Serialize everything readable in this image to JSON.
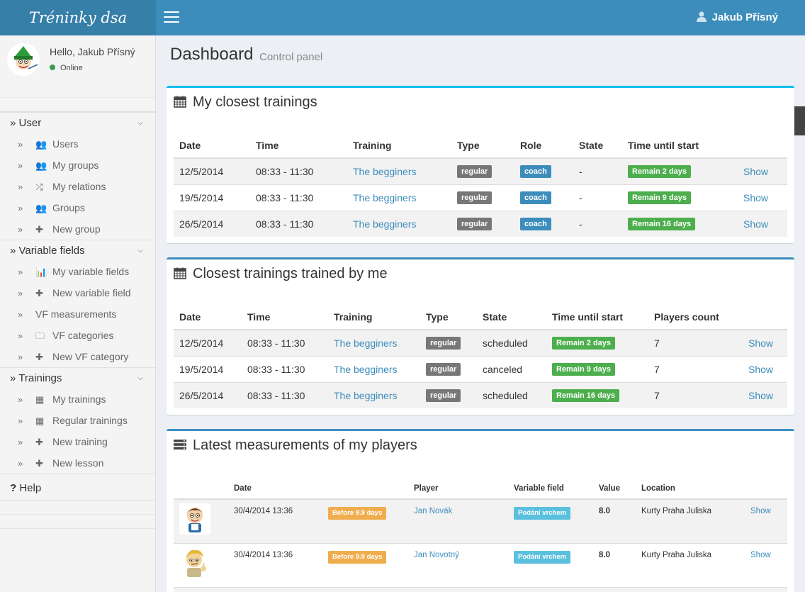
{
  "app": {
    "brand": "Tréninky dsa",
    "user_name": "Jakub Přísný"
  },
  "sidebar": {
    "hello": "Hello, Jakub Přísný",
    "status": "Online",
    "sections": [
      {
        "title": "User",
        "items": [
          {
            "label": "Users",
            "icon": "users-icon"
          },
          {
            "label": "My groups",
            "icon": "users-icon"
          },
          {
            "label": "My relations",
            "icon": "shuffle-icon"
          },
          {
            "label": "Groups",
            "icon": "users-icon"
          },
          {
            "label": "New group",
            "icon": "plus-icon"
          }
        ]
      },
      {
        "title": "Variable fields",
        "items": [
          {
            "label": "My variable fields",
            "icon": "bar-chart-icon"
          },
          {
            "label": "New variable field",
            "icon": "plus-icon"
          },
          {
            "label": "VF measurements",
            "icon": ""
          },
          {
            "label": "VF categories",
            "icon": "folder-icon"
          },
          {
            "label": "New VF category",
            "icon": "plus-icon"
          }
        ]
      },
      {
        "title": "Trainings",
        "items": [
          {
            "label": "My trainings",
            "icon": "grid-icon"
          },
          {
            "label": "Regular trainings",
            "icon": "grid-icon"
          },
          {
            "label": "New training",
            "icon": "plus-icon"
          },
          {
            "label": "New lesson",
            "icon": "plus-icon"
          }
        ]
      }
    ],
    "help": "Help"
  },
  "header": {
    "title": "Dashboard",
    "subtitle": "Control panel"
  },
  "box1": {
    "title": "My closest trainings",
    "columns": [
      "Date",
      "Time",
      "Training",
      "Type",
      "Role",
      "State",
      "Time until start"
    ],
    "rows": [
      {
        "date": "12/5/2014",
        "time": "08:33 - 11:30",
        "training": "The begginers",
        "type": "regular",
        "role": "coach",
        "state": "-",
        "until": "Remain 2 days",
        "action": "Show"
      },
      {
        "date": "19/5/2014",
        "time": "08:33 - 11:30",
        "training": "The begginers",
        "type": "regular",
        "role": "coach",
        "state": "-",
        "until": "Remain 9 days",
        "action": "Show"
      },
      {
        "date": "26/5/2014",
        "time": "08:33 - 11:30",
        "training": "The begginers",
        "type": "regular",
        "role": "coach",
        "state": "-",
        "until": "Remain 16 days",
        "action": "Show"
      }
    ]
  },
  "box2": {
    "title": "Closest trainings trained by me",
    "columns": [
      "Date",
      "Time",
      "Training",
      "Type",
      "State",
      "Time until start",
      "Players count"
    ],
    "rows": [
      {
        "date": "12/5/2014",
        "time": "08:33 - 11:30",
        "training": "The begginers",
        "type": "regular",
        "state": "scheduled",
        "until": "Remain 2 days",
        "players": "7",
        "action": "Show"
      },
      {
        "date": "19/5/2014",
        "time": "08:33 - 11:30",
        "training": "The begginers",
        "type": "regular",
        "state": "canceled",
        "until": "Remain 9 days",
        "players": "7",
        "action": "Show"
      },
      {
        "date": "26/5/2014",
        "time": "08:33 - 11:30",
        "training": "The begginers",
        "type": "regular",
        "state": "scheduled",
        "until": "Remain 16 days",
        "players": "7",
        "action": "Show"
      }
    ]
  },
  "box3": {
    "title": "Latest measurements of my players",
    "columns": [
      "Date",
      "Player",
      "Variable field",
      "Value",
      "Location"
    ],
    "rows": [
      {
        "date": "30/4/2014 13:36",
        "ago": "Before 9.9 days",
        "player": "Jan Novák",
        "field": "Podání vrchem",
        "value": "8.0",
        "location": "Kurty Praha Juliska",
        "action": "Show"
      },
      {
        "date": "30/4/2014 13:36",
        "ago": "Before 9.9 days",
        "player": "Jan Novotný",
        "field": "Podání vrchem",
        "value": "8.0",
        "location": "Kurty Praha Juliska",
        "action": "Show"
      }
    ]
  },
  "colors": {
    "primary": "#3c8dbc",
    "brand_bg": "#367fa9",
    "success": "#4cae4c",
    "warning": "#f0ad4e",
    "info": "#5bc0de",
    "default": "#777777"
  }
}
